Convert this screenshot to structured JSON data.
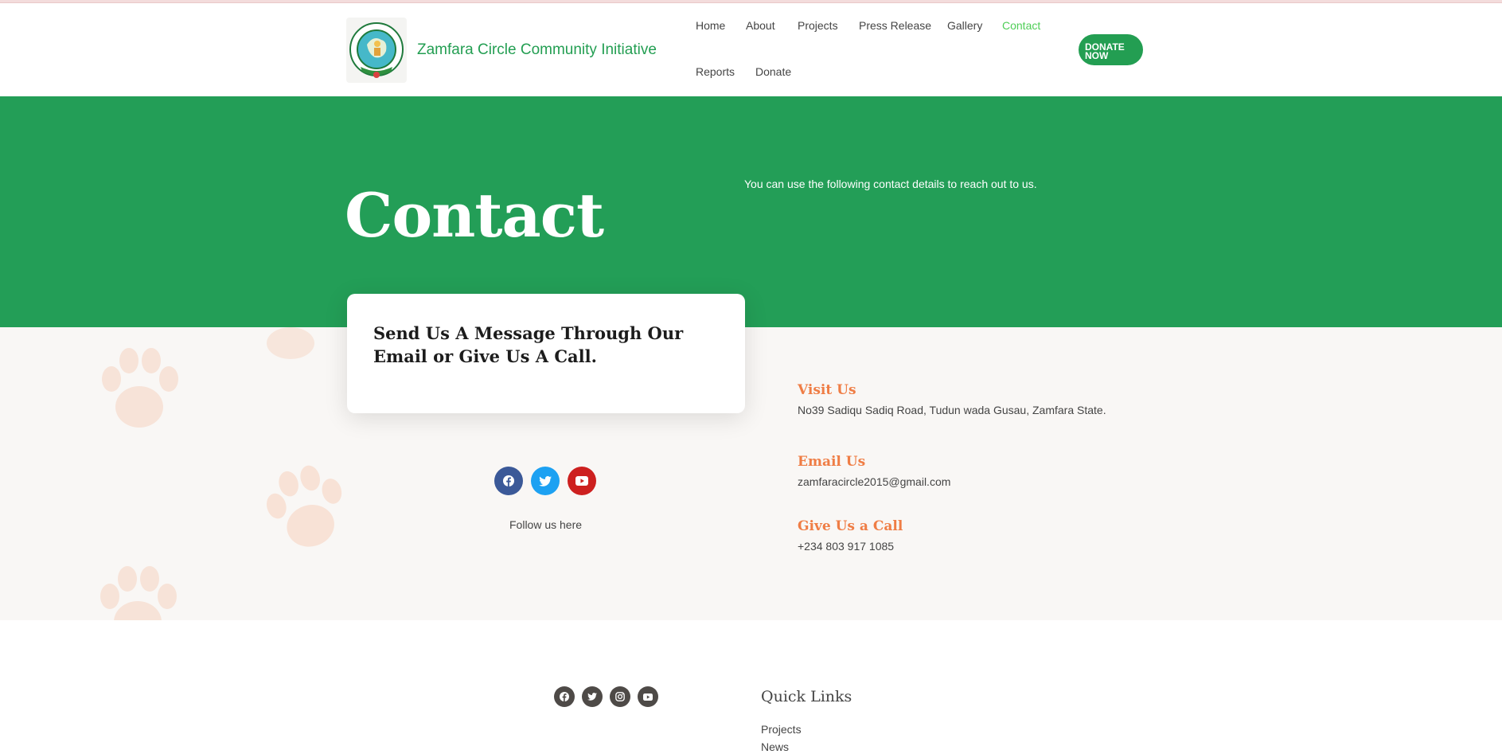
{
  "header": {
    "site_title": "Zamfara Circle Community Initiative",
    "logo_text": "ZAMFARA CIRCLE COMMUNITY INITIATIVE",
    "nav": [
      {
        "label": "Home"
      },
      {
        "label": "About"
      },
      {
        "label": "Projects"
      },
      {
        "label": "Press Release"
      },
      {
        "label": "Gallery"
      },
      {
        "label": "Contact",
        "active": true
      },
      {
        "label": "Reports"
      },
      {
        "label": "Donate"
      }
    ],
    "donate_button": {
      "line1": "DONATE",
      "line2": "NOW"
    }
  },
  "hero": {
    "title": "Contact",
    "text": "You can use the following contact details to reach out to us."
  },
  "message_card": {
    "heading": "Send Us A Message Through Our Email or Give Us A Call."
  },
  "social": {
    "icons": [
      "facebook-icon",
      "twitter-icon",
      "youtube-icon"
    ],
    "follow_text": "Follow us here"
  },
  "contact_info": {
    "visit": {
      "heading": "Visit Us",
      "text": "No39 Sadiqu Sadiq Road, Tudun wada Gusau, Zamfara State."
    },
    "email": {
      "heading": "Email Us",
      "text": "zamfaracircle2015@gmail.com"
    },
    "call": {
      "heading": "Give Us a Call",
      "text": "+234 803 917 1085"
    }
  },
  "footer": {
    "social_icons": [
      "facebook-icon",
      "twitter-icon",
      "instagram-icon",
      "youtube-icon"
    ],
    "quick_links_title": "Quick Links",
    "quick_links": [
      "Projects",
      "News"
    ]
  },
  "colors": {
    "brand_green": "#239e57",
    "active_nav": "#4fce57",
    "accent_orange": "#ef7d45",
    "facebook": "#3b5998",
    "twitter": "#1da1f2",
    "youtube": "#cd201f"
  }
}
